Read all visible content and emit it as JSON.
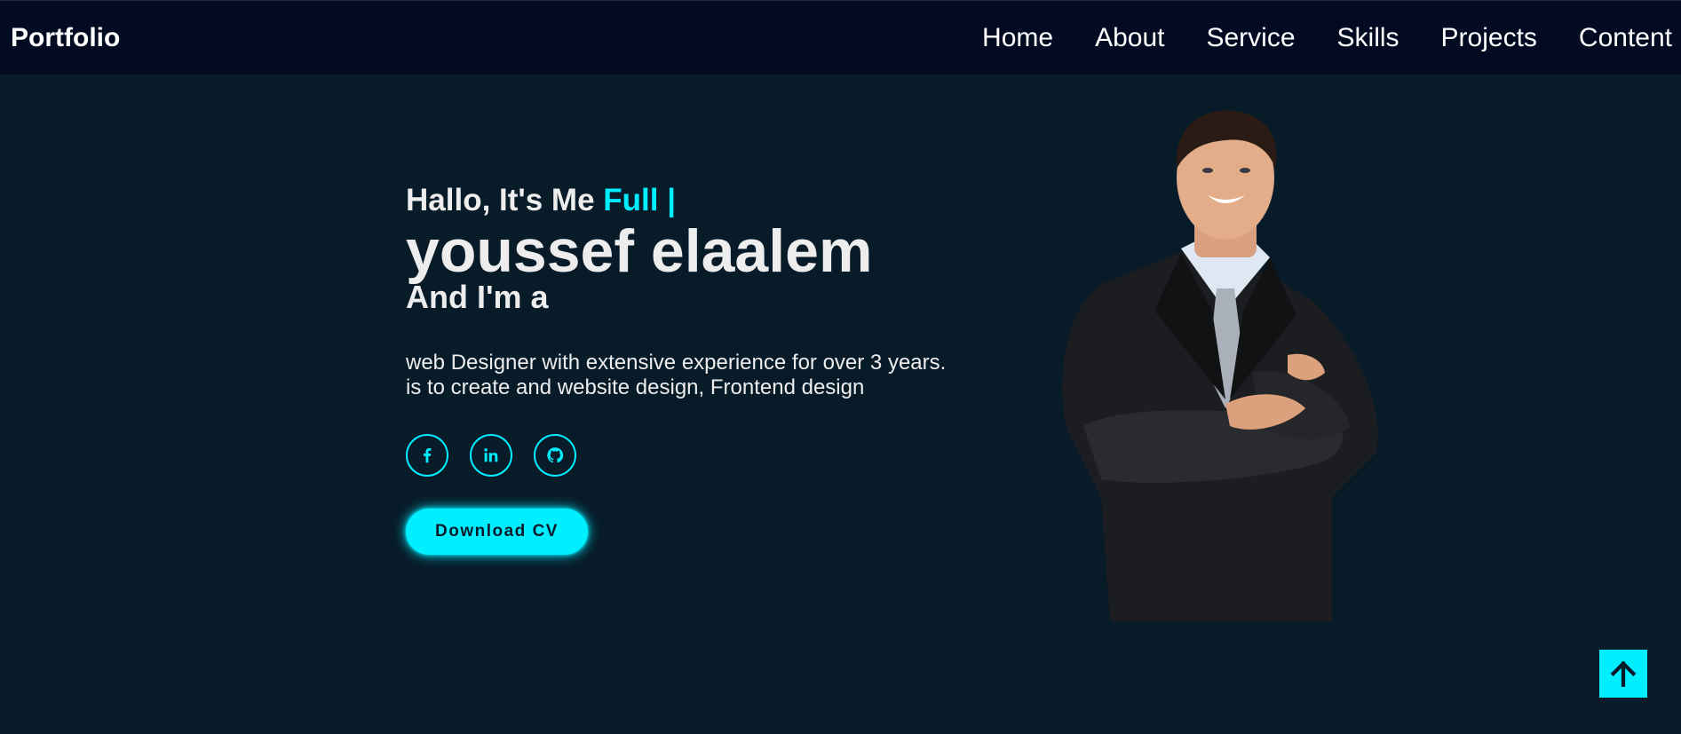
{
  "nav": {
    "logo": "Portfolio",
    "links": [
      "Home",
      "About",
      "Service",
      "Skills",
      "Projects",
      "Content"
    ]
  },
  "hero": {
    "greeting": "Hallo, It's Me",
    "typed": "Full |",
    "name": "youssef elaalem",
    "role": "And I'm a",
    "description_line1": "web Designer with extensive experience for over 3 years.",
    "description_line2": "is to create and website design, Frontend design",
    "socials": [
      "facebook-icon",
      "linkedin-icon",
      "github-icon"
    ],
    "cta_label": "Download CV"
  },
  "colors": {
    "background": "#081b29",
    "navbar": "#020b22",
    "accent": "#00eeff",
    "text": "#ededed"
  },
  "scroll_top_icon": "arrow-up-icon"
}
